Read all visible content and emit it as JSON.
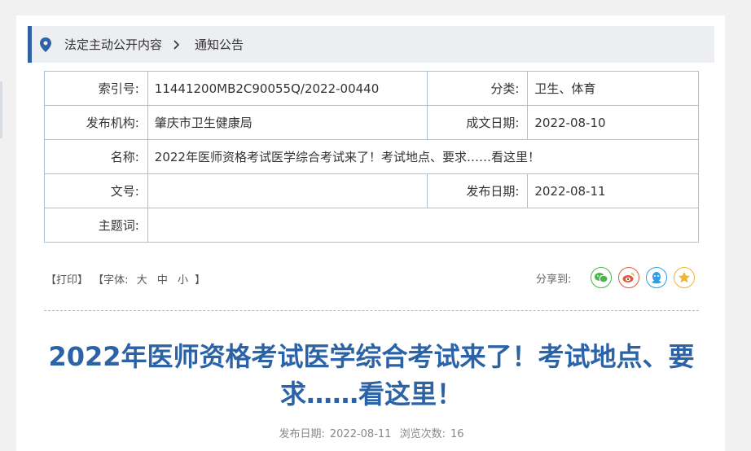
{
  "breadcrumb": {
    "items": [
      "法定主动公开内容",
      "通知公告"
    ]
  },
  "info": {
    "index_label": "索引号:",
    "index_value": "11441200MB2C90055Q/2022-00440",
    "category_label": "分类:",
    "category_value": "卫生、体育",
    "publisher_label": "发布机构:",
    "publisher_value": "肇庆市卫生健康局",
    "created_label": "成文日期:",
    "created_value": "2022-08-10",
    "name_label": "名称:",
    "name_value": "2022年医师资格考试医学综合考试来了！考试地点、要求……看这里！",
    "docno_label": "文号:",
    "docno_value": "",
    "published_label": "发布日期:",
    "published_value": "2022-08-11",
    "subject_label": "主题词:",
    "subject_value": ""
  },
  "tools": {
    "print": "【打印】",
    "font_prefix": "【字体:",
    "font_large": "大",
    "font_medium": "中",
    "font_small": "小",
    "font_suffix": "】"
  },
  "share": {
    "label": "分享到:",
    "icons": [
      "wechat-icon",
      "weibo-icon",
      "qq-icon",
      "qzone-icon"
    ],
    "colors": {
      "wechat": "#4ab64a",
      "weibo": "#e05a3a",
      "qq": "#2f9ee2",
      "qzone": "#f2b233"
    }
  },
  "article": {
    "title": "2022年医师资格考试医学综合考试来了！考试地点、要求……看这里！",
    "date_label": "发布日期:",
    "date_value": "2022-08-11",
    "views_label": "浏览次数:",
    "views_value": "16"
  },
  "colors": {
    "accent": "#2e62a0",
    "title": "#2b63a6",
    "border": "#a9c2d8"
  }
}
